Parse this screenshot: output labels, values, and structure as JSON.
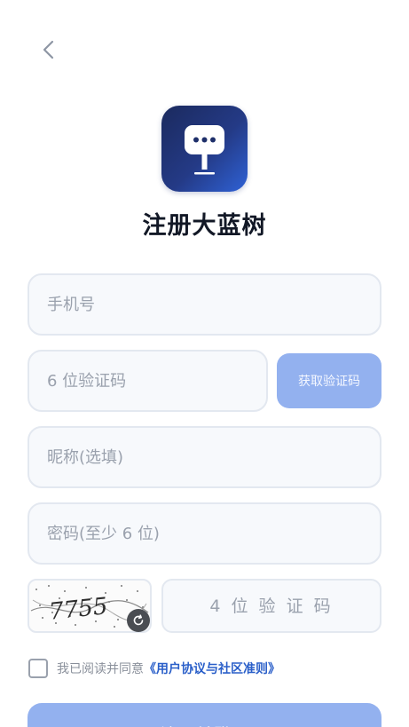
{
  "header": {
    "back_icon": "chevron-left-icon"
  },
  "logo": {
    "icon": "chat-sign-icon"
  },
  "title": "注册大蓝树",
  "form": {
    "phone_placeholder": "手机号",
    "sms_code_placeholder": "6 位验证码",
    "get_code_label": "获取验证码",
    "nickname_placeholder": "昵称(选填)",
    "password_placeholder": "密码(至少 6 位)",
    "captcha_text": "7755",
    "captcha_placeholder": "4 位 验 证 码",
    "refresh_icon": "refresh-icon"
  },
  "agreement": {
    "prefix": "我已阅读并同意",
    "link": "《用户协议与社区准则》",
    "checked": false
  },
  "submit_label": "注册并登录",
  "colors": {
    "primary_disabled": "#93b1ef",
    "link": "#2a5fc9",
    "logo_gradient_start": "#1b2a5e",
    "logo_gradient_end": "#2f62d6"
  }
}
